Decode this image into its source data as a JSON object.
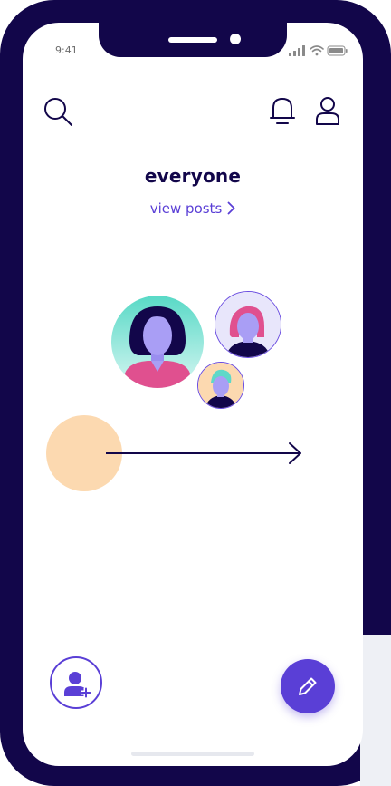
{
  "status_bar": {
    "time": "9:41"
  },
  "header": {
    "search_icon": "search-icon",
    "notification_icon": "bell-icon",
    "profile_icon": "user-icon"
  },
  "main": {
    "title": "everyone",
    "view_posts_label": "view posts"
  },
  "actions": {
    "add_user_icon": "add-user-icon",
    "compose_icon": "pencil-icon"
  },
  "colors": {
    "frame": "#12064a",
    "accent": "#5a3fd6",
    "peach": "#fcd9b0",
    "teal": "#5fd8c8",
    "pink": "#e0508f"
  }
}
